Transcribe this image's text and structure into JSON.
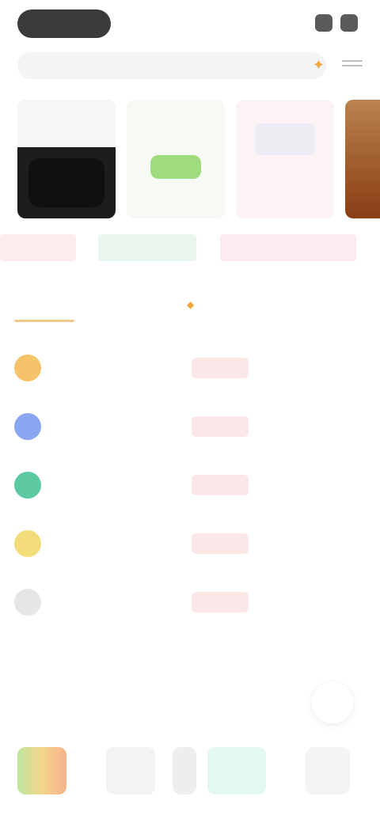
{
  "header": {
    "brand": "",
    "search": {
      "placeholder": "",
      "value": ""
    }
  },
  "banners": [
    {
      "caption": ""
    },
    {
      "caption": ""
    },
    {
      "caption": ""
    }
  ],
  "category_tabs": [
    {
      "label": ""
    },
    {
      "label": ""
    },
    {
      "label": ""
    }
  ],
  "table": {
    "columns": [
      "",
      "",
      "",
      ""
    ],
    "rows": [
      {
        "name": "",
        "sub": "",
        "change": "",
        "value": "",
        "color": "#f6c26a"
      },
      {
        "name": "",
        "sub": "",
        "change": "",
        "value": "",
        "color": "#8aa6f0"
      },
      {
        "name": "",
        "sub": "",
        "change": "",
        "value": "",
        "color": "#5cc9a0"
      },
      {
        "name": "",
        "sub": "",
        "change": "",
        "value": "",
        "color": "#f3dc7a"
      },
      {
        "name": "",
        "sub": "",
        "change": "",
        "value": "",
        "color": "#e6e6e6"
      }
    ]
  },
  "more_label": "",
  "section": {
    "title": "",
    "more": ""
  },
  "minis": [
    {
      "label": ""
    },
    {
      "label": ""
    },
    {
      "label": ""
    },
    {
      "label": ""
    },
    {
      "label": ""
    }
  ],
  "colors": {
    "accent": "#f0a63a",
    "down": "#e0505e",
    "up": "#3aa867"
  }
}
